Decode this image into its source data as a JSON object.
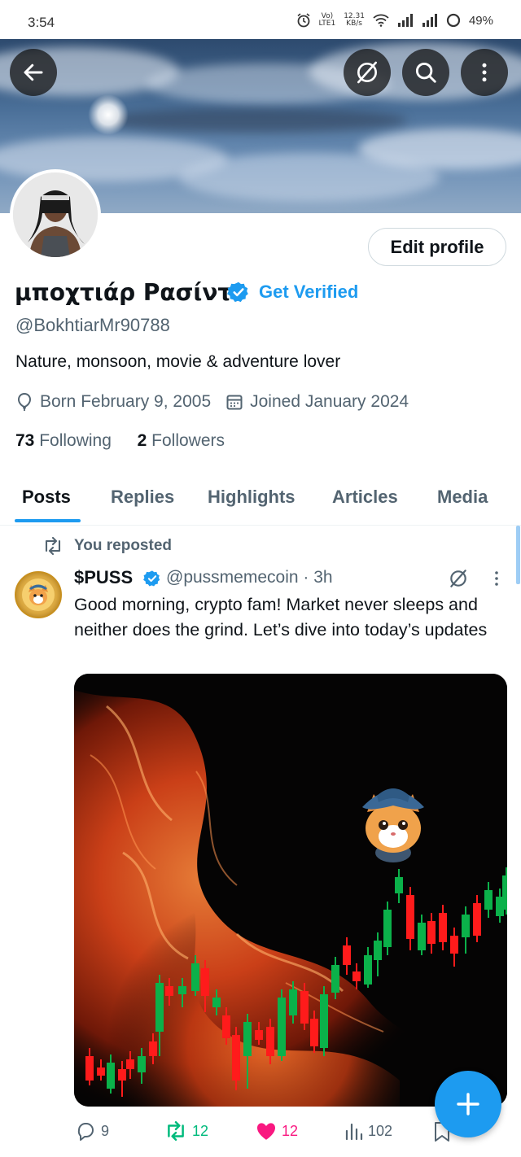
{
  "status_bar": {
    "time": "3:54",
    "network_top": "Vo)",
    "network_bottom": "LTE1",
    "speed_top": "12.31",
    "speed_bottom": "KB/s",
    "battery": "49%"
  },
  "header": {
    "back_icon": "arrow-left-icon",
    "grok_icon": "grok-slash-circle-icon",
    "search_icon": "search-icon",
    "more_icon": "more-vertical-icon"
  },
  "profile": {
    "display_name": "μποχτιάρ Ρασίντ",
    "get_verified": "Get Verified",
    "handle": "@BokhtiarMr90788",
    "bio": "Nature, monsoon, movie & adventure lover",
    "born": "Born February 9, 2005",
    "joined": "Joined January 2024",
    "following_count": "73",
    "following_label": "Following",
    "followers_count": "2",
    "followers_label": "Followers",
    "edit_profile": "Edit profile"
  },
  "tabs": [
    "Posts",
    "Replies",
    "Highlights",
    "Articles",
    "Media"
  ],
  "active_tab": "Posts",
  "post": {
    "repost_label": "You reposted",
    "author_name": "$PUSS",
    "author_meta": "@pussmemecoin · 3h",
    "text": "Good morning, crypto fam!  Market never sleeps and neither does the grind. Let’s dive into today’s updates",
    "replies": "9",
    "reposts": "12",
    "likes": "12",
    "views": "102"
  },
  "colors": {
    "accent": "#1d9bf0",
    "repost_green": "#00ba7c",
    "like_pink": "#f91880",
    "muted_text": "#536471",
    "candle_up": "#0bb14a",
    "candle_down": "#ff1b1b"
  }
}
